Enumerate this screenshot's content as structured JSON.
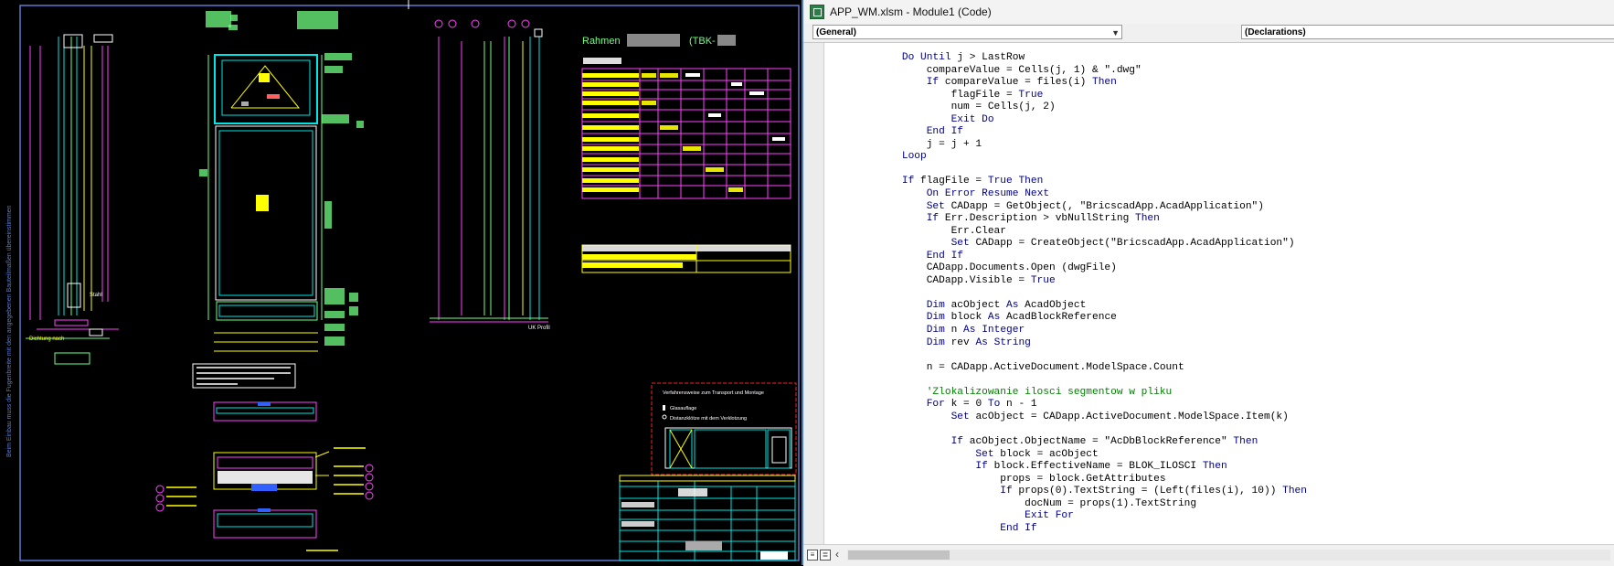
{
  "cad": {
    "title_label": "Rahmen",
    "title_code": "(TBK-",
    "profile_label_left": "Stahl",
    "profile_label_right": "UK Profil",
    "note_left": "Dichtung nach",
    "legend_title": "Verfahrensweise zum Transport und Montage",
    "legend_item_1": "Glasauflage",
    "legend_item_2": "Distanzklötze mit dem Verklotzung",
    "side_text": "Beim Einbau muss die Fugenbreite mit den angegebenen Bauteilmaßen übereinstimmen",
    "colors": {
      "cyan": "#00e5e5",
      "green": "#6fff80",
      "yellow": "#ffff00",
      "magenta": "#ff40ff",
      "red": "#ff2020",
      "blue": "#3060ff",
      "white": "#ffffff"
    }
  },
  "vba": {
    "window_title": "APP_WM.xlsm - Module1 (Code)",
    "object_combo": "(General)",
    "procedure_combo": "(Declarations)",
    "code_lines": [
      "    Do Until j > LastRow",
      "        compareValue = Cells(j, 1) & \".dwg\"",
      "        If compareValue = files(i) Then",
      "            flagFile = True",
      "            num = Cells(j, 2)",
      "            Exit Do",
      "        End If",
      "        j = j + 1",
      "    Loop",
      "",
      "    If flagFile = True Then",
      "        On Error Resume Next",
      "        Set CADapp = GetObject(, \"BricscadApp.AcadApplication\")",
      "        If Err.Description > vbNullString Then",
      "            Err.Clear",
      "            Set CADapp = CreateObject(\"BricscadApp.AcadApplication\")",
      "        End If",
      "        CADapp.Documents.Open (dwgFile)",
      "        CADapp.Visible = True",
      "",
      "        Dim acObject As AcadObject",
      "        Dim block As AcadBlockReference",
      "        Dim n As Integer",
      "        Dim rev As String",
      "",
      "        n = CADapp.ActiveDocument.ModelSpace.Count",
      "",
      "        'Zlokalizowanie ilosci segmentow w pliku",
      "        For k = 0 To n - 1",
      "            Set acObject = CADapp.ActiveDocument.ModelSpace.Item(k)",
      "",
      "            If acObject.ObjectName = \"AcDbBlockReference\" Then",
      "                Set block = acObject",
      "                If block.EffectiveName = BLOK_ILOSCI Then",
      "                    props = block.GetAttributes",
      "                    If props(0).TextString = (Left(files(i), 10)) Then",
      "                        docNum = props(1).TextString",
      "                        Exit For",
      "                    End If"
    ]
  }
}
